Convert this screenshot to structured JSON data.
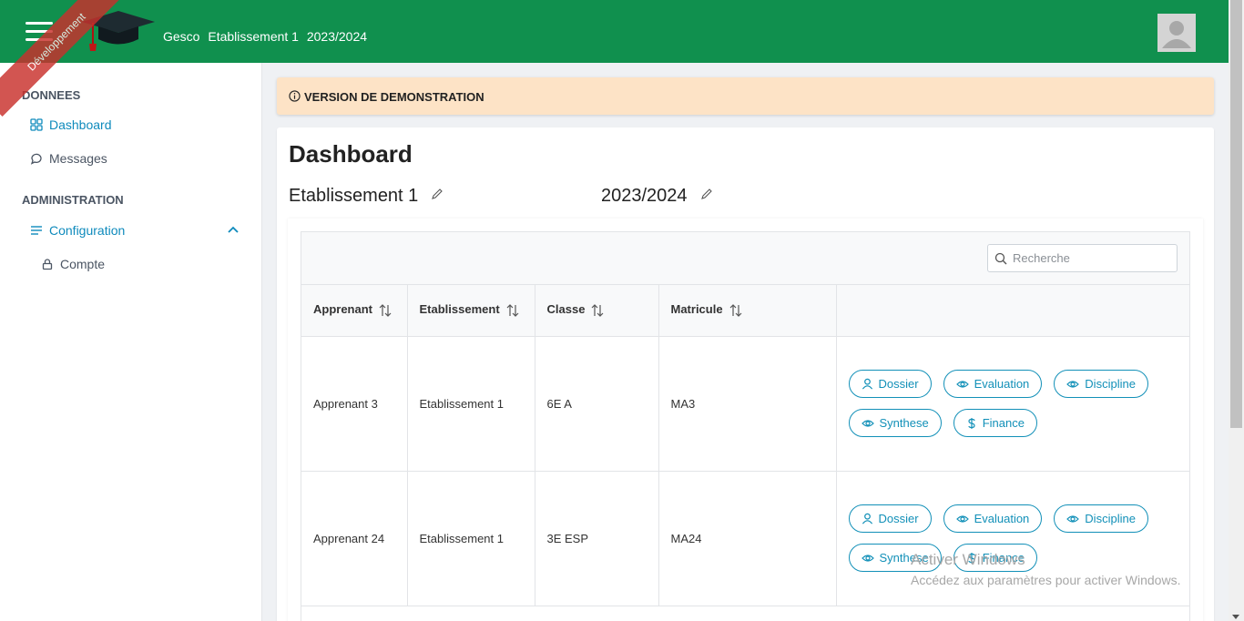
{
  "header": {
    "title_parts": [
      "Gesco",
      "Etablissement 1",
      "2023/2024"
    ],
    "ribbon": "Développement"
  },
  "sidebar": {
    "sections": [
      {
        "title": "DONNEES",
        "items": [
          {
            "label": "Dashboard",
            "icon": "grid-icon",
            "active": true
          },
          {
            "label": "Messages",
            "icon": "chat-icon",
            "active": false
          }
        ]
      },
      {
        "title": "ADMINISTRATION",
        "items": [
          {
            "label": "Configuration",
            "icon": "list-icon",
            "active": true,
            "expanded": true
          },
          {
            "label": "Compte",
            "icon": "lock-icon",
            "active": false
          }
        ]
      }
    ]
  },
  "banner": {
    "text": "VERSION DE DEMONSTRATION",
    "icon": "info-icon"
  },
  "main": {
    "title": "Dashboard",
    "etablissement": "Etablissement 1",
    "annee": "2023/2024"
  },
  "search": {
    "placeholder": "Recherche"
  },
  "table": {
    "columns": [
      "Apprenant",
      "Etablissement",
      "Classe",
      "Matricule",
      ""
    ],
    "rows": [
      {
        "apprenant": "Apprenant 3",
        "etablissement": "Etablissement 1",
        "classe": "6E A",
        "matricule": "MA3"
      },
      {
        "apprenant": "Apprenant 24",
        "etablissement": "Etablissement 1",
        "classe": "3E ESP",
        "matricule": "MA24"
      }
    ],
    "actions": [
      "Dossier",
      "Evaluation",
      "Discipline",
      "Synthese",
      "Finance"
    ]
  },
  "watermark": {
    "line1": "Activer Windows",
    "line2": "Accédez aux paramètres pour activer Windows."
  },
  "colors": {
    "header": "#10904e",
    "accent": "#1290b8",
    "banner": "#fde3c6"
  }
}
